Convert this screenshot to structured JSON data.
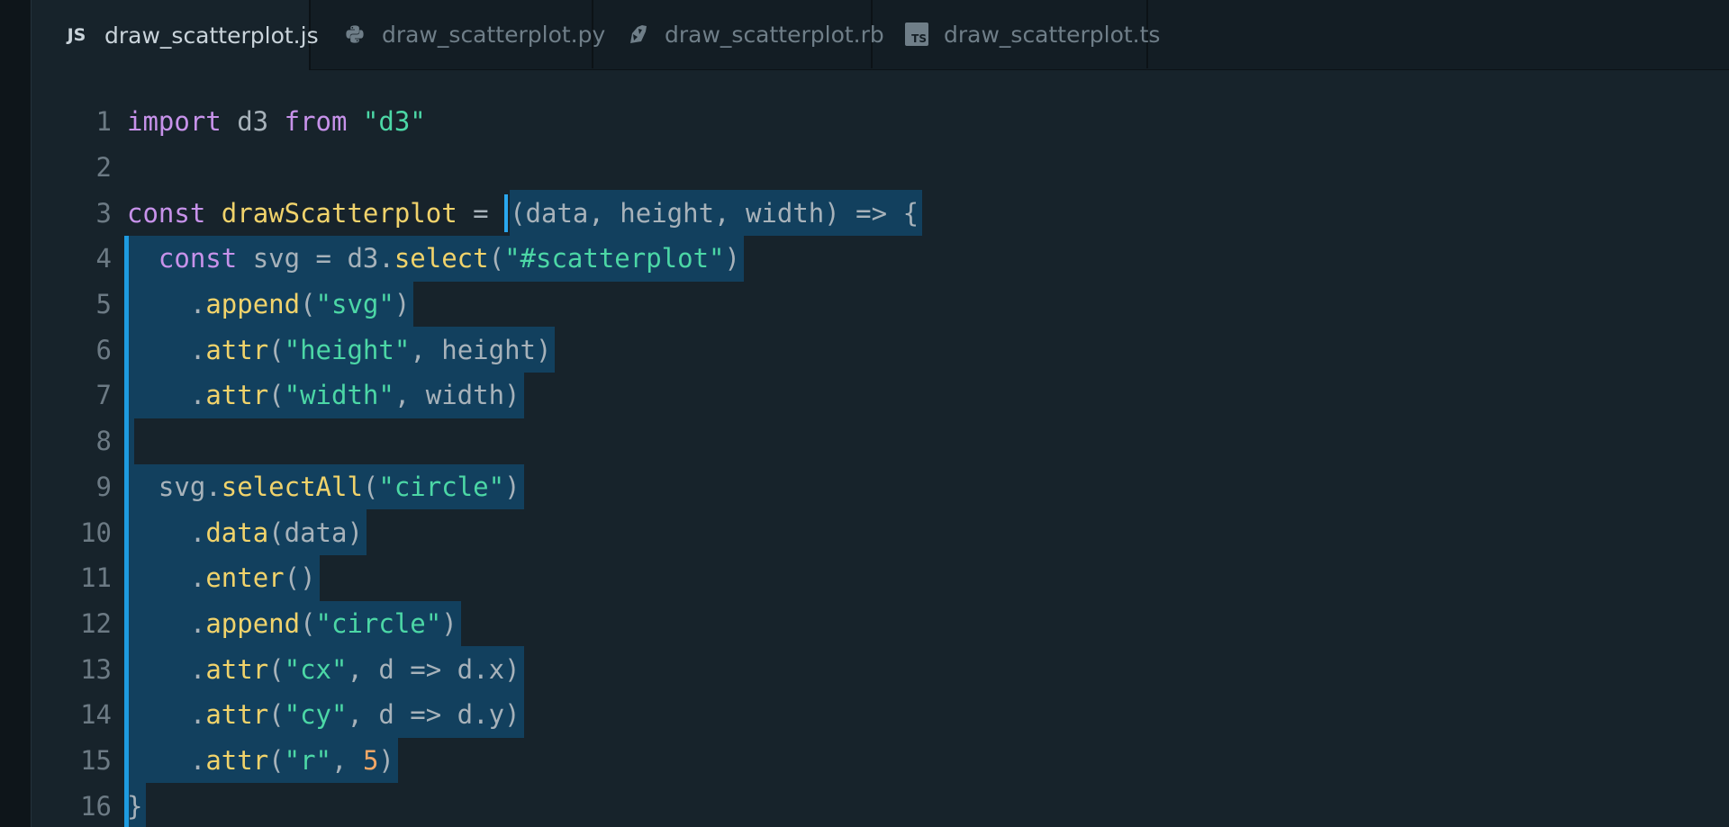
{
  "tabs": [
    {
      "name": "tab-draw-scatterplot-js",
      "icon": "javascript-icon",
      "icon_text": "JS",
      "label": "draw_scatterplot.js",
      "active": true
    },
    {
      "name": "tab-draw-scatterplot-py",
      "icon": "python-icon",
      "label": "draw_scatterplot.py",
      "active": false
    },
    {
      "name": "tab-draw-scatterplot-rb",
      "icon": "ruby-icon",
      "label": "draw_scatterplot.rb",
      "active": false
    },
    {
      "name": "tab-draw-scatterplot-ts",
      "icon": "typescript-icon",
      "icon_text": "TS",
      "label": "draw_scatterplot.ts",
      "active": false
    }
  ],
  "editor": {
    "lines": [
      {
        "n": "1",
        "tokens": [
          [
            "kw",
            "import"
          ],
          [
            "pl",
            " d3 "
          ],
          [
            "kw",
            "from"
          ],
          [
            "pl",
            " "
          ],
          [
            "str",
            "\"d3\""
          ]
        ]
      },
      {
        "n": "2",
        "tokens": []
      },
      {
        "n": "3",
        "tokens": [
          [
            "kw",
            "const"
          ],
          [
            "pl",
            " "
          ],
          [
            "fn",
            "drawScatterplot"
          ],
          [
            "pl",
            " = "
          ]
        ],
        "sel_tokens": [
          [
            "pl",
            "(data, height, width) => {"
          ]
        ]
      },
      {
        "n": "4",
        "sel_tokens": [
          [
            "pl",
            "  "
          ],
          [
            "kw",
            "const"
          ],
          [
            "pl",
            " svg = d3."
          ],
          [
            "fn",
            "select"
          ],
          [
            "pl",
            "("
          ],
          [
            "str",
            "\"#scatterplot\""
          ],
          [
            "pl",
            ")"
          ]
        ]
      },
      {
        "n": "5",
        "sel_tokens": [
          [
            "pl",
            "    ."
          ],
          [
            "fn",
            "append"
          ],
          [
            "pl",
            "("
          ],
          [
            "str",
            "\"svg\""
          ],
          [
            "pl",
            ")"
          ]
        ]
      },
      {
        "n": "6",
        "sel_tokens": [
          [
            "pl",
            "    ."
          ],
          [
            "fn",
            "attr"
          ],
          [
            "pl",
            "("
          ],
          [
            "str",
            "\"height\""
          ],
          [
            "pl",
            ", height)"
          ]
        ]
      },
      {
        "n": "7",
        "sel_tokens": [
          [
            "pl",
            "    ."
          ],
          [
            "fn",
            "attr"
          ],
          [
            "pl",
            "("
          ],
          [
            "str",
            "\"width\""
          ],
          [
            "pl",
            ", width)"
          ]
        ]
      },
      {
        "n": "8",
        "sel_tokens": []
      },
      {
        "n": "9",
        "sel_tokens": [
          [
            "pl",
            "  svg."
          ],
          [
            "fn",
            "selectAll"
          ],
          [
            "pl",
            "("
          ],
          [
            "str",
            "\"circle\""
          ],
          [
            "pl",
            ")"
          ]
        ]
      },
      {
        "n": "10",
        "sel_tokens": [
          [
            "pl",
            "    ."
          ],
          [
            "fn",
            "data"
          ],
          [
            "pl",
            "(data)"
          ]
        ]
      },
      {
        "n": "11",
        "sel_tokens": [
          [
            "pl",
            "    ."
          ],
          [
            "fn",
            "enter"
          ],
          [
            "pl",
            "()"
          ]
        ]
      },
      {
        "n": "12",
        "sel_tokens": [
          [
            "pl",
            "    ."
          ],
          [
            "fn",
            "append"
          ],
          [
            "pl",
            "("
          ],
          [
            "str",
            "\"circle\""
          ],
          [
            "pl",
            ")"
          ]
        ]
      },
      {
        "n": "13",
        "sel_tokens": [
          [
            "pl",
            "    ."
          ],
          [
            "fn",
            "attr"
          ],
          [
            "pl",
            "("
          ],
          [
            "str",
            "\"cx\""
          ],
          [
            "pl",
            ", d => d.x)"
          ]
        ]
      },
      {
        "n": "14",
        "sel_tokens": [
          [
            "pl",
            "    ."
          ],
          [
            "fn",
            "attr"
          ],
          [
            "pl",
            "("
          ],
          [
            "str",
            "\"cy\""
          ],
          [
            "pl",
            ", d => d.y)"
          ]
        ]
      },
      {
        "n": "15",
        "sel_tokens": [
          [
            "pl",
            "    ."
          ],
          [
            "fn",
            "attr"
          ],
          [
            "pl",
            "("
          ],
          [
            "str",
            "\"r\""
          ],
          [
            "pl",
            ", "
          ],
          [
            "num",
            "5"
          ],
          [
            "pl",
            ")"
          ]
        ]
      },
      {
        "n": "16",
        "sel_tokens": [
          [
            "pl",
            "}"
          ]
        ]
      }
    ]
  },
  "colors": {
    "background": "#17232b",
    "selection": "#12405e",
    "keyword": "#c792ea",
    "function": "#f1d36b",
    "string": "#4cd7a6",
    "number": "#f3a766",
    "plain": "#a7b2ba",
    "caret": "#2aa7ee"
  }
}
